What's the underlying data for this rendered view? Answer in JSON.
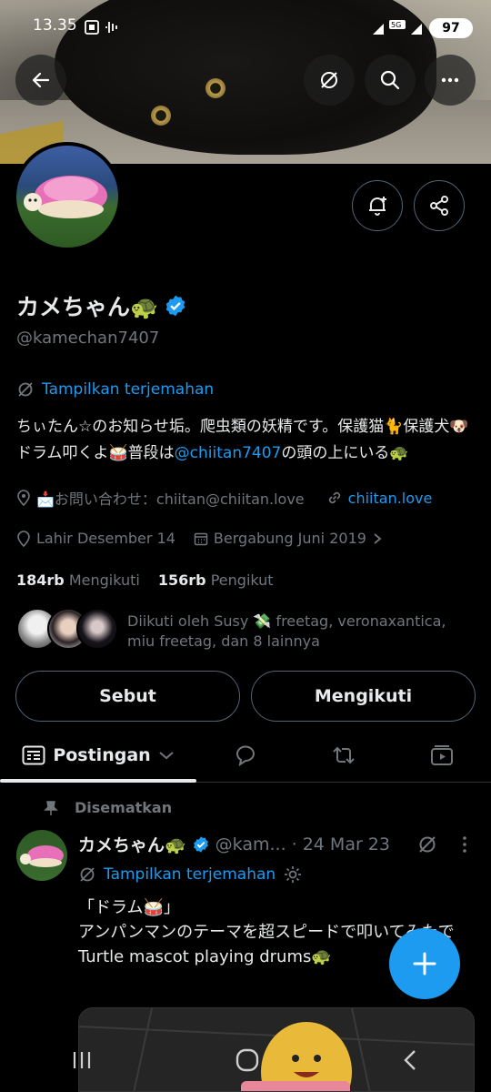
{
  "status_bar": {
    "time": "13.35",
    "battery": "97",
    "network": "5G"
  },
  "header": {
    "back_icon": "arrow-left-icon",
    "translate_icon": "translate-off-icon",
    "search_icon": "search-icon",
    "more_icon": "more-horizontal-icon"
  },
  "profile": {
    "name": "カメちゃん🐢",
    "handle": "@kamechan7407",
    "translate_label": "Tampilkan terjemahan",
    "bio_pre": "ちぃたん☆のお知らせ垢。爬虫類の妖精です。保護猫🐈保護犬🐶ドラム叩くよ🥁普段は",
    "bio_link": "@chiitan7407",
    "bio_post": "の頭の上にいる🐢",
    "contact": "📩お問い合わせ：chiitan@chiitan.love",
    "website": "chiitan.love",
    "birthday": "Lahir Desember 14",
    "joined": "Bergabung Juni 2019",
    "following_count": "184rb",
    "following_label": "Mengikuti",
    "followers_count": "156rb",
    "followers_label": "Pengikut",
    "followed_by": "Diikuti oleh Susy 💸 freetag, veronaxantica, miu freetag, dan 8 lainnya"
  },
  "actions": {
    "mention": "Sebut",
    "following": "Mengikuti"
  },
  "tabs": {
    "posts": "Postingan"
  },
  "pinned_post": {
    "pinned_label": "Disematkan",
    "author": "カメちゃん🐢",
    "handle": "@kam...",
    "date": "· 24 Mar 23",
    "translate_label": "Tampilkan terjemahan",
    "line1": "「ドラム🥁」",
    "line2": "アンパンマンのテーマを超スピードで叩いてみたで",
    "line3": "Turtle mascot playing drums🐢"
  },
  "colors": {
    "accent": "#1d9bf0",
    "background": "#000000",
    "text": "#e7e9ea",
    "muted": "#71767b",
    "border": "#2f3336"
  }
}
